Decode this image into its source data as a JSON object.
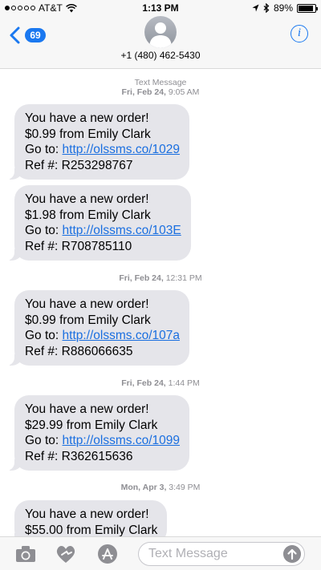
{
  "status_bar": {
    "carrier": "AT&T",
    "time": "1:13 PM",
    "battery": "89%",
    "battery_level": 0.89,
    "icons": [
      "signal-dots-icon",
      "wifi-icon",
      "location-arrow-icon",
      "bluetooth-icon",
      "battery-icon"
    ]
  },
  "header": {
    "back_count": "69",
    "contact": "+1 (480) 462-5430",
    "info_glyph": "i",
    "avatar_icon": "person-silhouette-icon"
  },
  "thread": {
    "header_label": "Text Message",
    "stamps": [
      {
        "day": "Fri, Feb 24,",
        "time": "9:05 AM"
      },
      {
        "day": "Fri, Feb 24,",
        "time": "12:31 PM"
      },
      {
        "day": "Fri, Feb 24,",
        "time": "1:44 PM"
      },
      {
        "day": "Mon, Apr 3,",
        "time": "3:49 PM"
      }
    ],
    "messages": [
      {
        "line1": "You have a new order!",
        "line2": "$0.99 from Emily Clark",
        "goto": "Go to: ",
        "link": "http://olssms.co/1029",
        "ref": "Ref #: R253298767"
      },
      {
        "line1": "You have a new order!",
        "line2": "$1.98 from Emily Clark",
        "goto": "Go to: ",
        "link": "http://olssms.co/103E",
        "ref": "Ref #: R708785110"
      },
      {
        "line1": "You have a new order!",
        "line2": "$0.99 from Emily Clark",
        "goto": "Go to: ",
        "link": "http://olssms.co/107a",
        "ref": "Ref #: R886066635"
      },
      {
        "line1": "You have a new order!",
        "line2": "$29.99 from Emily Clark",
        "goto": "Go to: ",
        "link": "http://olssms.co/1099",
        "ref": "Ref #: R362615636"
      },
      {
        "line1": "You have a new order!",
        "line2": "$55.00 from Emily Clark"
      }
    ]
  },
  "input_bar": {
    "placeholder": "Text Message",
    "icons": [
      "camera-icon",
      "digital-touch-heart-icon",
      "app-store-icon",
      "send-arrow-icon"
    ]
  },
  "colors": {
    "accent": "#1a78f0",
    "bubble": "#e5e5ea",
    "timestamp": "#8e8e93"
  }
}
